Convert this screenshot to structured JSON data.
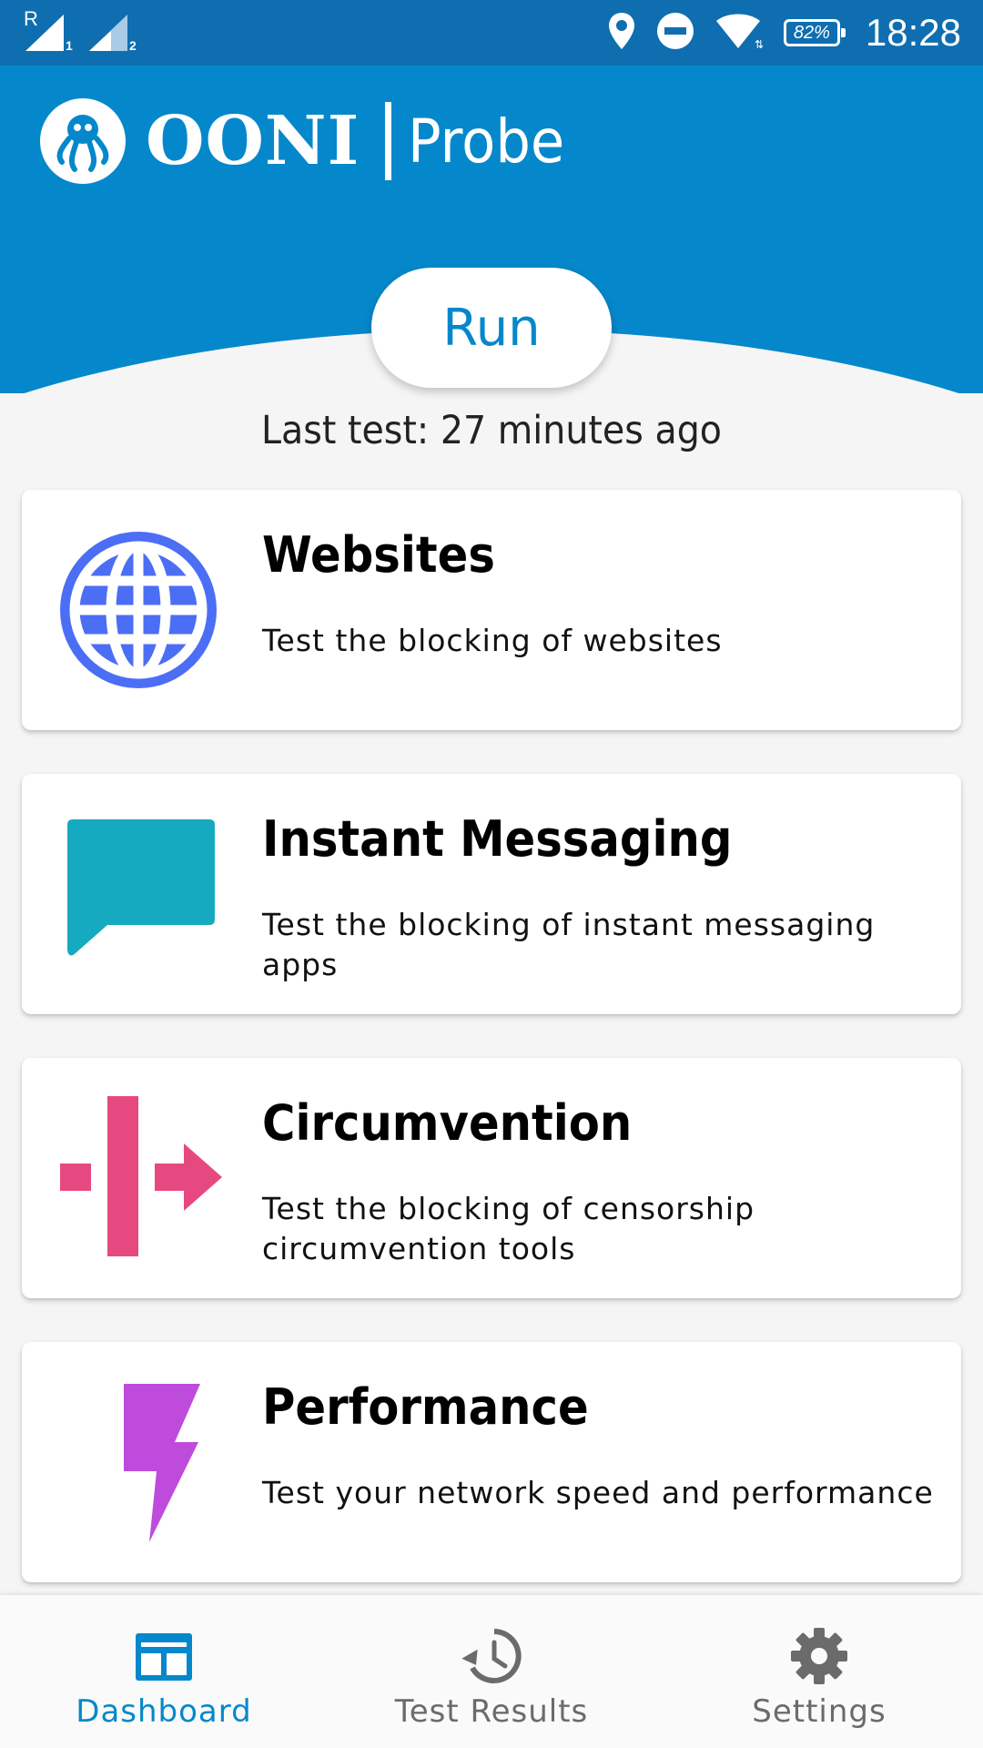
{
  "status_bar": {
    "time": "18:28",
    "battery": "82%",
    "sim1_label": "1",
    "sim2_label": "2",
    "roaming_label": "R",
    "icons": [
      "signal-icon",
      "signal-icon",
      "location-icon",
      "do-not-disturb-icon",
      "wifi-icon",
      "battery-icon"
    ]
  },
  "header": {
    "brand": "OONI",
    "product": "Probe",
    "color": "#0588cb"
  },
  "run_button": {
    "label": "Run"
  },
  "last_test": "Last test: 27 minutes ago",
  "cards": [
    {
      "title": "Websites",
      "description": "Test the blocking of websites",
      "icon": "globe-icon",
      "color": "#4c6ef5"
    },
    {
      "title": "Instant Messaging",
      "description": "Test the blocking of instant messaging apps",
      "icon": "chat-bubble-icon",
      "color": "#15aabf"
    },
    {
      "title": "Circumvention",
      "description": "Test the blocking of censorship circumvention tools",
      "icon": "circumvention-icon",
      "color": "#e64980"
    },
    {
      "title": "Performance",
      "description": "Test your network speed and performance",
      "icon": "lightning-icon",
      "color": "#be4bdb"
    }
  ],
  "bottom_nav": {
    "items": [
      {
        "label": "Dashboard",
        "icon": "dashboard-icon",
        "active": true
      },
      {
        "label": "Test Results",
        "icon": "history-icon",
        "active": false
      },
      {
        "label": "Settings",
        "icon": "gear-icon",
        "active": false
      }
    ],
    "active_color": "#0588cb",
    "inactive_color": "#6b6b6b"
  }
}
